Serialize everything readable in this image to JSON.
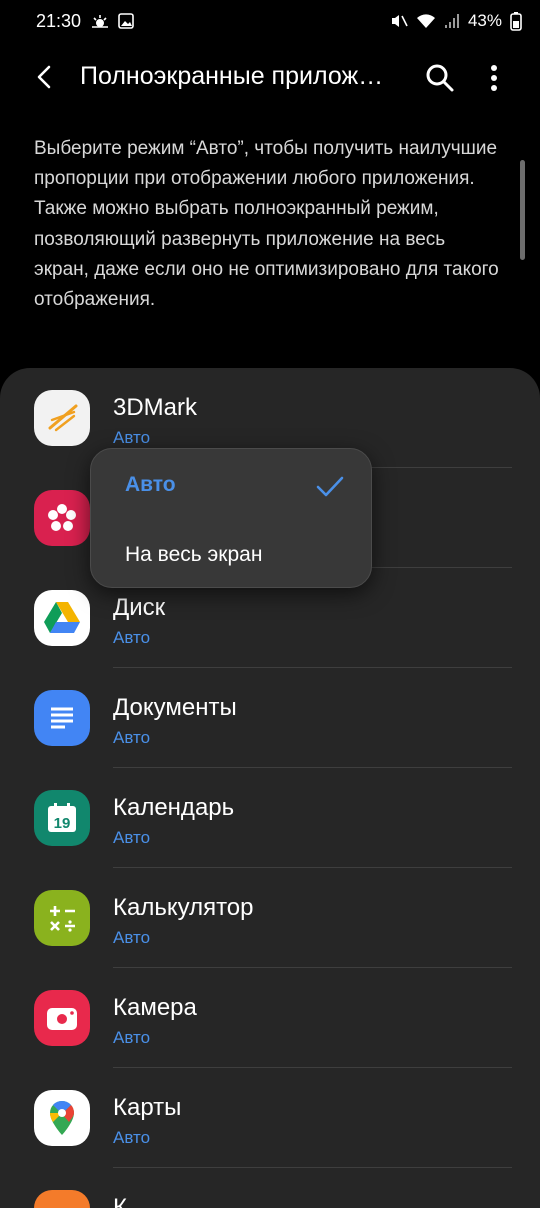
{
  "status_bar": {
    "time": "21:30",
    "battery": "43%"
  },
  "header": {
    "title": "Полноэкранные прилож…"
  },
  "description": "Выберите режим “Авто”, чтобы получить наилучшие пропорции при отображении любого приложения. Также можно выбрать полноэкранный режим, позволяющий развернуть приложение на весь экран, даже если оно не оптимизировано для такого отображения.",
  "apps": [
    {
      "name": "3DMark",
      "mode": "Авто"
    },
    {
      "name": "",
      "mode": ""
    },
    {
      "name": "Диск",
      "mode": "Авто"
    },
    {
      "name": "Документы",
      "mode": "Авто"
    },
    {
      "name": "Календарь",
      "mode": "Авто"
    },
    {
      "name": "Калькулятор",
      "mode": "Авто"
    },
    {
      "name": "Камера",
      "mode": "Авто"
    },
    {
      "name": "Карты",
      "mode": "Авто"
    },
    {
      "name": "К…",
      "mode": ""
    }
  ],
  "calendar_day": "19",
  "popup": {
    "options": [
      "Авто",
      "На весь экран"
    ],
    "selected": "Авто"
  },
  "colors": {
    "accent": "#4a90e8",
    "card": "#262626",
    "popup": "#383838"
  }
}
